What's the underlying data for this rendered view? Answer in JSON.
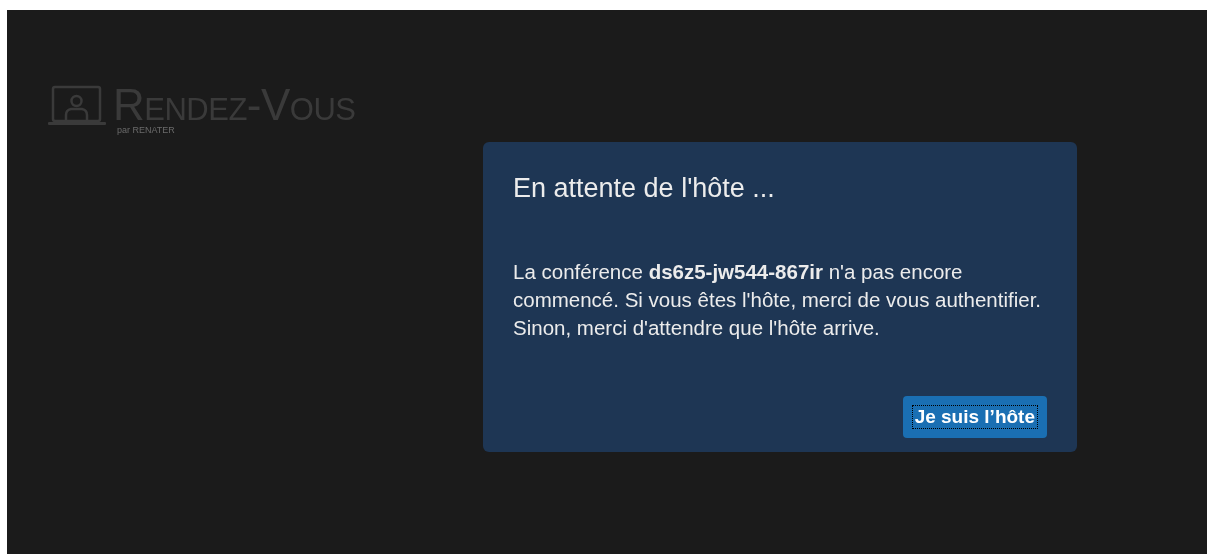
{
  "logo": {
    "name": "Rendez-Vous",
    "tagline": "par RENATER"
  },
  "dialog": {
    "title": "En attente de l'hôte ...",
    "message": "La conférence **ds6z5-jw544-867ir** n'a pas encore commencé. Si vous êtes l'hôte, merci de vous authentifier. Sinon, merci d'attendre que l'hôte arrive.",
    "button": {
      "label": "Je suis l’hôte",
      "focused": true
    }
  }
}
